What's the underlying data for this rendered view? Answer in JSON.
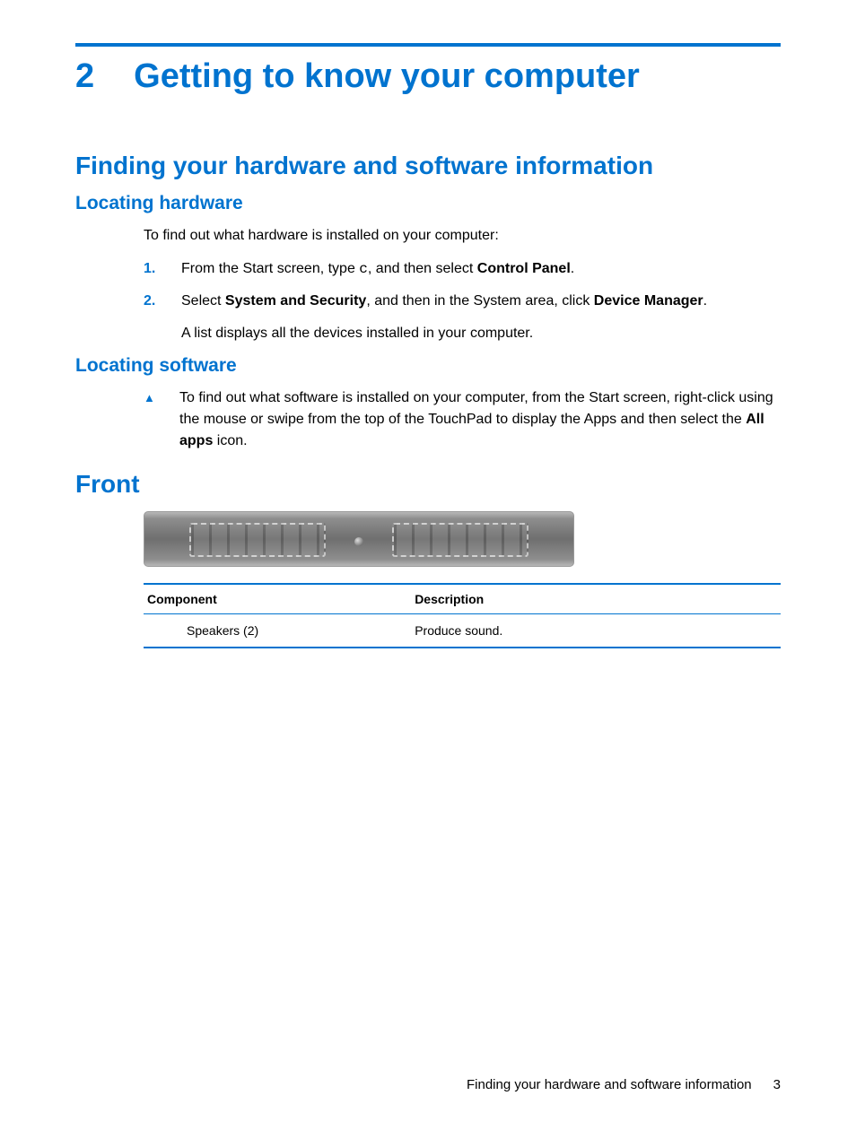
{
  "chapter": {
    "number": "2",
    "title": "Getting to know your computer"
  },
  "section1": {
    "title": "Finding your hardware and software information",
    "sub1": {
      "title": "Locating hardware",
      "intro": "To find out what hardware is installed on your computer:",
      "steps": [
        {
          "n": "1.",
          "pre": "From the Start screen, type ",
          "code": "c",
          "mid": ", and then select ",
          "bold": "Control Panel",
          "post": "."
        },
        {
          "n": "2.",
          "pre": "Select ",
          "bold1": "System and Security",
          "mid": ", and then in the System area, click ",
          "bold2": "Device Manager",
          "post": "."
        }
      ],
      "note_after": "A list displays all the devices installed in your computer."
    },
    "sub2": {
      "title": "Locating software",
      "bullet": {
        "pre": "To find out what software is installed on your computer, from the Start screen, right-click using the mouse or swipe from the top of the TouchPad to display the Apps and then select the ",
        "bold": "All apps",
        "post": " icon."
      }
    }
  },
  "section2": {
    "title": "Front",
    "table": {
      "headers": [
        "Component",
        "Description"
      ],
      "rows": [
        {
          "component": "Speakers (2)",
          "description": "Produce sound."
        }
      ]
    }
  },
  "footer": {
    "text": "Finding your hardware and software information",
    "page": "3"
  }
}
